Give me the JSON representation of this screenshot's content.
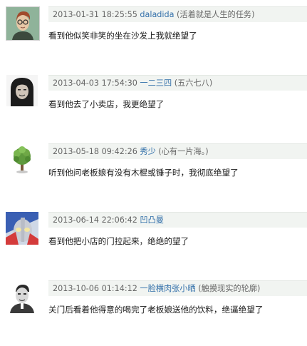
{
  "comments": [
    {
      "timestamp": "2013-01-31 18:25:55",
      "username": "daladida",
      "signature": "(活着就是人生的任务)",
      "text": "看到他似笑非笑的坐在沙发上我就绝望了",
      "avatar": "man-with-glasses-avatar"
    },
    {
      "timestamp": "2013-04-03 17:54:30",
      "username": "一二三四",
      "signature": "(五六七八)",
      "text": "看到他去了小卖店，我更绝望了",
      "avatar": "man-with-long-hair-avatar"
    },
    {
      "timestamp": "2013-05-18 09:42:26",
      "username": "秀少",
      "signature": "(心有一片海。)",
      "text": "听到他问老板娘有没有木棍或锤子时，我彻底绝望了",
      "avatar": "plant-tree-avatar"
    },
    {
      "timestamp": "2013-06-14 22:06:42",
      "username": "凹凸曼",
      "signature": "",
      "text": "看到他把小店的门拉起来，绝绝的望了",
      "avatar": "ultraman-avatar"
    },
    {
      "timestamp": "2013-10-06 01:14:12",
      "username": "一脸横肉张小晒",
      "signature": "(触摸现实的轮廓)",
      "text": "关门后看着他得意的喝完了老板娘送他的饮料，绝逼绝望了",
      "avatar": "man-bw-portrait-avatar"
    }
  ],
  "colors": {
    "meta_background": "#f1f4f1",
    "username_link": "#3370aa",
    "timestamp_text": "#666666"
  }
}
